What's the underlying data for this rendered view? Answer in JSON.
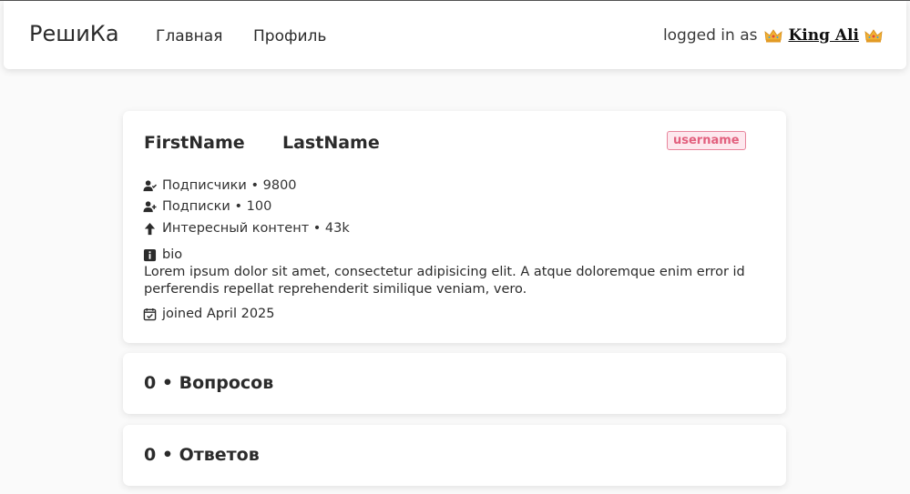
{
  "navbar": {
    "brand": "РешиКа",
    "links": [
      {
        "label": "Главная"
      },
      {
        "label": "Профиль"
      }
    ],
    "logged_in_prefix": "logged in as",
    "user_name": "King Ali",
    "user_icons": [
      "crown-icon",
      "crown-icon"
    ]
  },
  "profile": {
    "first_name": "FirstName",
    "last_name": "LastName",
    "username": "username",
    "stats": {
      "followers": "Подписчики • 9800",
      "following": "Подписки • 100",
      "content": "Интересный контент • 43k"
    },
    "bio_label": "bio",
    "bio_text": "Lorem ipsum dolor sit amet, consectetur adipisicing elit. A atque doloremque enim error id perferendis repellat reprehenderit similique veniam, vero.",
    "joined": "joined April 2025",
    "colors": {
      "badge_text": "#e2607e",
      "badge_bg": "#fde8ee"
    }
  },
  "sections": {
    "questions": "0 • Вопросов",
    "answers": "0 • Ответов"
  }
}
